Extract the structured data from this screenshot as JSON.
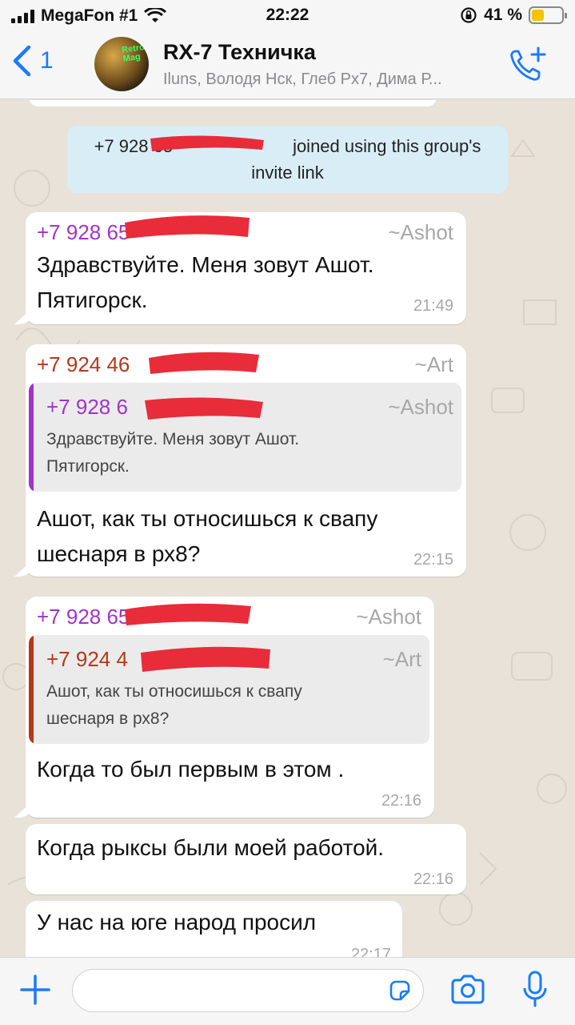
{
  "status_bar": {
    "carrier": "MegaFon #1",
    "time": "22:22",
    "battery_percent": "41 %",
    "battery_level": 0.41,
    "icons": [
      "signal-bars-icon",
      "wifi-icon",
      "orientation-lock-icon",
      "battery-icon"
    ]
  },
  "header": {
    "back_count": "1",
    "title": "RX-7 Техничка",
    "subtitle": "Iluns, Володя Нск, Глеб Рх7, Дима Р...",
    "icons": [
      "back-chevron-icon",
      "add-call-icon"
    ]
  },
  "chat": {
    "system_message": {
      "prefix": "+7 928 65",
      "text": "joined using this group's",
      "line2": "invite link"
    },
    "messages": [
      {
        "sender": "+7 928 65",
        "sender_color": "#a233c8",
        "pushname": "~Ashot",
        "line1": "Здравствуйте.  Меня зовут Ашот.",
        "line2": "Пятигорск.",
        "time": "21:49"
      },
      {
        "sender": "+7 924 46",
        "sender_color": "#b5381a",
        "pushname": "~Art",
        "quote": {
          "sender": "+7 928 6",
          "sender_color": "#a233c8",
          "pushname": "~Ashot",
          "line1": "Здравствуйте.  Меня зовут Ашот.",
          "line2": "Пятигорск."
        },
        "line1": "Ашот, как ты относишься к свапу",
        "line2": "шеснаря в рх8?",
        "time": "22:15"
      },
      {
        "sender": "+7 928 65",
        "sender_color": "#a233c8",
        "pushname": "~Ashot",
        "quote": {
          "sender": "+7 924 4",
          "sender_color": "#b5381a",
          "pushname": "~Art",
          "line1": "Ашот, как ты относишься к свапу",
          "line2": "шеснаря в рх8?"
        },
        "line1": "Когда то был первым в этом .",
        "time": "22:16"
      },
      {
        "line1": "Когда рыксы  были моей работой.",
        "time": "22:16"
      },
      {
        "line1": "У нас на юге народ  просил",
        "time": "22:17"
      }
    ]
  },
  "input_bar": {
    "placeholder": "",
    "icons": [
      "plus-icon",
      "sticker-icon",
      "camera-icon",
      "microphone-icon"
    ],
    "accent_color": "#1a7cf5"
  }
}
